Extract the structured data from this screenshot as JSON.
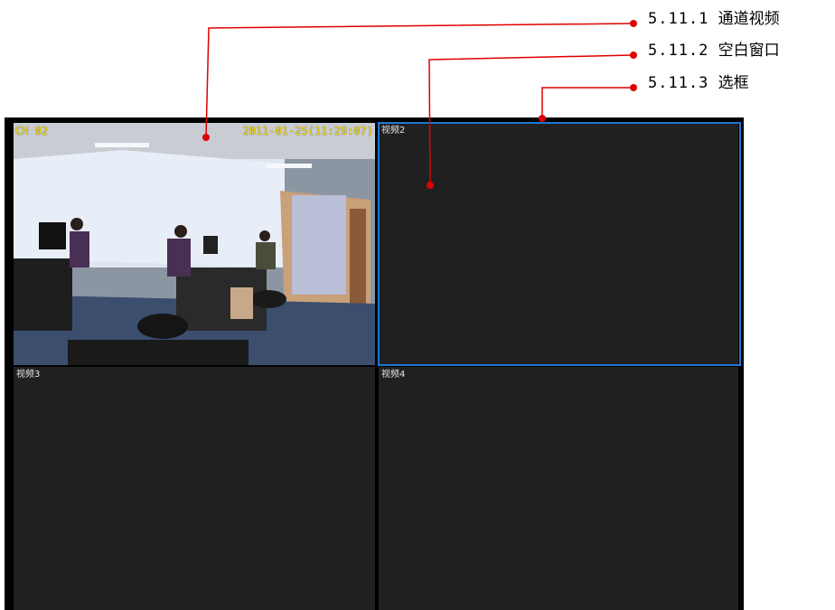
{
  "panes": [
    {
      "label": "",
      "osd_channel": "CH 02",
      "osd_timestamp": "2011-01-25(11:29:07)"
    },
    {
      "label": "视频2"
    },
    {
      "label": "视频3"
    },
    {
      "label": "视频4"
    }
  ],
  "callouts": [
    {
      "number": "5.11.1",
      "text": "通道视频"
    },
    {
      "number": "5.11.2",
      "text": "空白窗口"
    },
    {
      "number": "5.11.3",
      "text": "选框"
    }
  ],
  "colors": {
    "leader_line": "#e00000",
    "selection_border": "#1e78d2",
    "osd_text": "#ffe000",
    "empty_pane": "#202020"
  }
}
